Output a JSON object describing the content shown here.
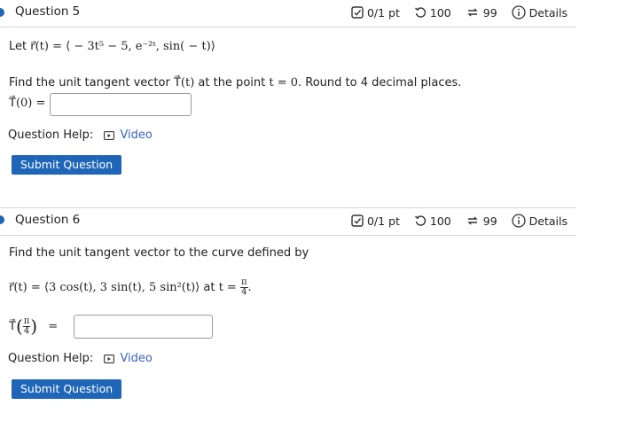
{
  "colors": {
    "accent": "#1f66b8",
    "link": "#3a63c6",
    "dot": "#1f66b8"
  },
  "questions": [
    {
      "title": "Question 5",
      "score": "0/1 pt",
      "retries": "100",
      "attempts": "99",
      "details": "Details",
      "intro_prefix": "Let ",
      "intro_math": "r⃗(t) = ⟨ − 3t⁵ − 5, e⁻²ᵗ, sin( − t)⟩",
      "prompt_prefix": "Find the unit tangent vector ",
      "prompt_math_vec": "T⃗(t)",
      "prompt_mid": " at the point ",
      "prompt_math_point": "t = 0",
      "prompt_suffix": ". Round to 4 decimal places.",
      "answer_label": "T⃗(0) =",
      "answer_value": "",
      "help_label": "Question Help:",
      "video_label": "Video",
      "submit_label": "Submit Question"
    },
    {
      "title": "Question 6",
      "score": "0/1 pt",
      "retries": "100",
      "attempts": "99",
      "details": "Details",
      "intro_text": "Find the unit tangent vector to the curve defined by",
      "curve_math": "r⃗(t) = ⟨3 cos(t), 3 sin(t), 5 sin²(t)⟩",
      "at_text": " at ",
      "at_math": "t = ",
      "at_frac_num": "π",
      "at_frac_den": "4",
      "answer_label_vec": "T⃗",
      "answer_frac_num": "π",
      "answer_frac_den": "4",
      "answer_equals": "=",
      "answer_value": "",
      "help_label": "Question Help:",
      "video_label": "Video",
      "submit_label": "Submit Question"
    }
  ]
}
